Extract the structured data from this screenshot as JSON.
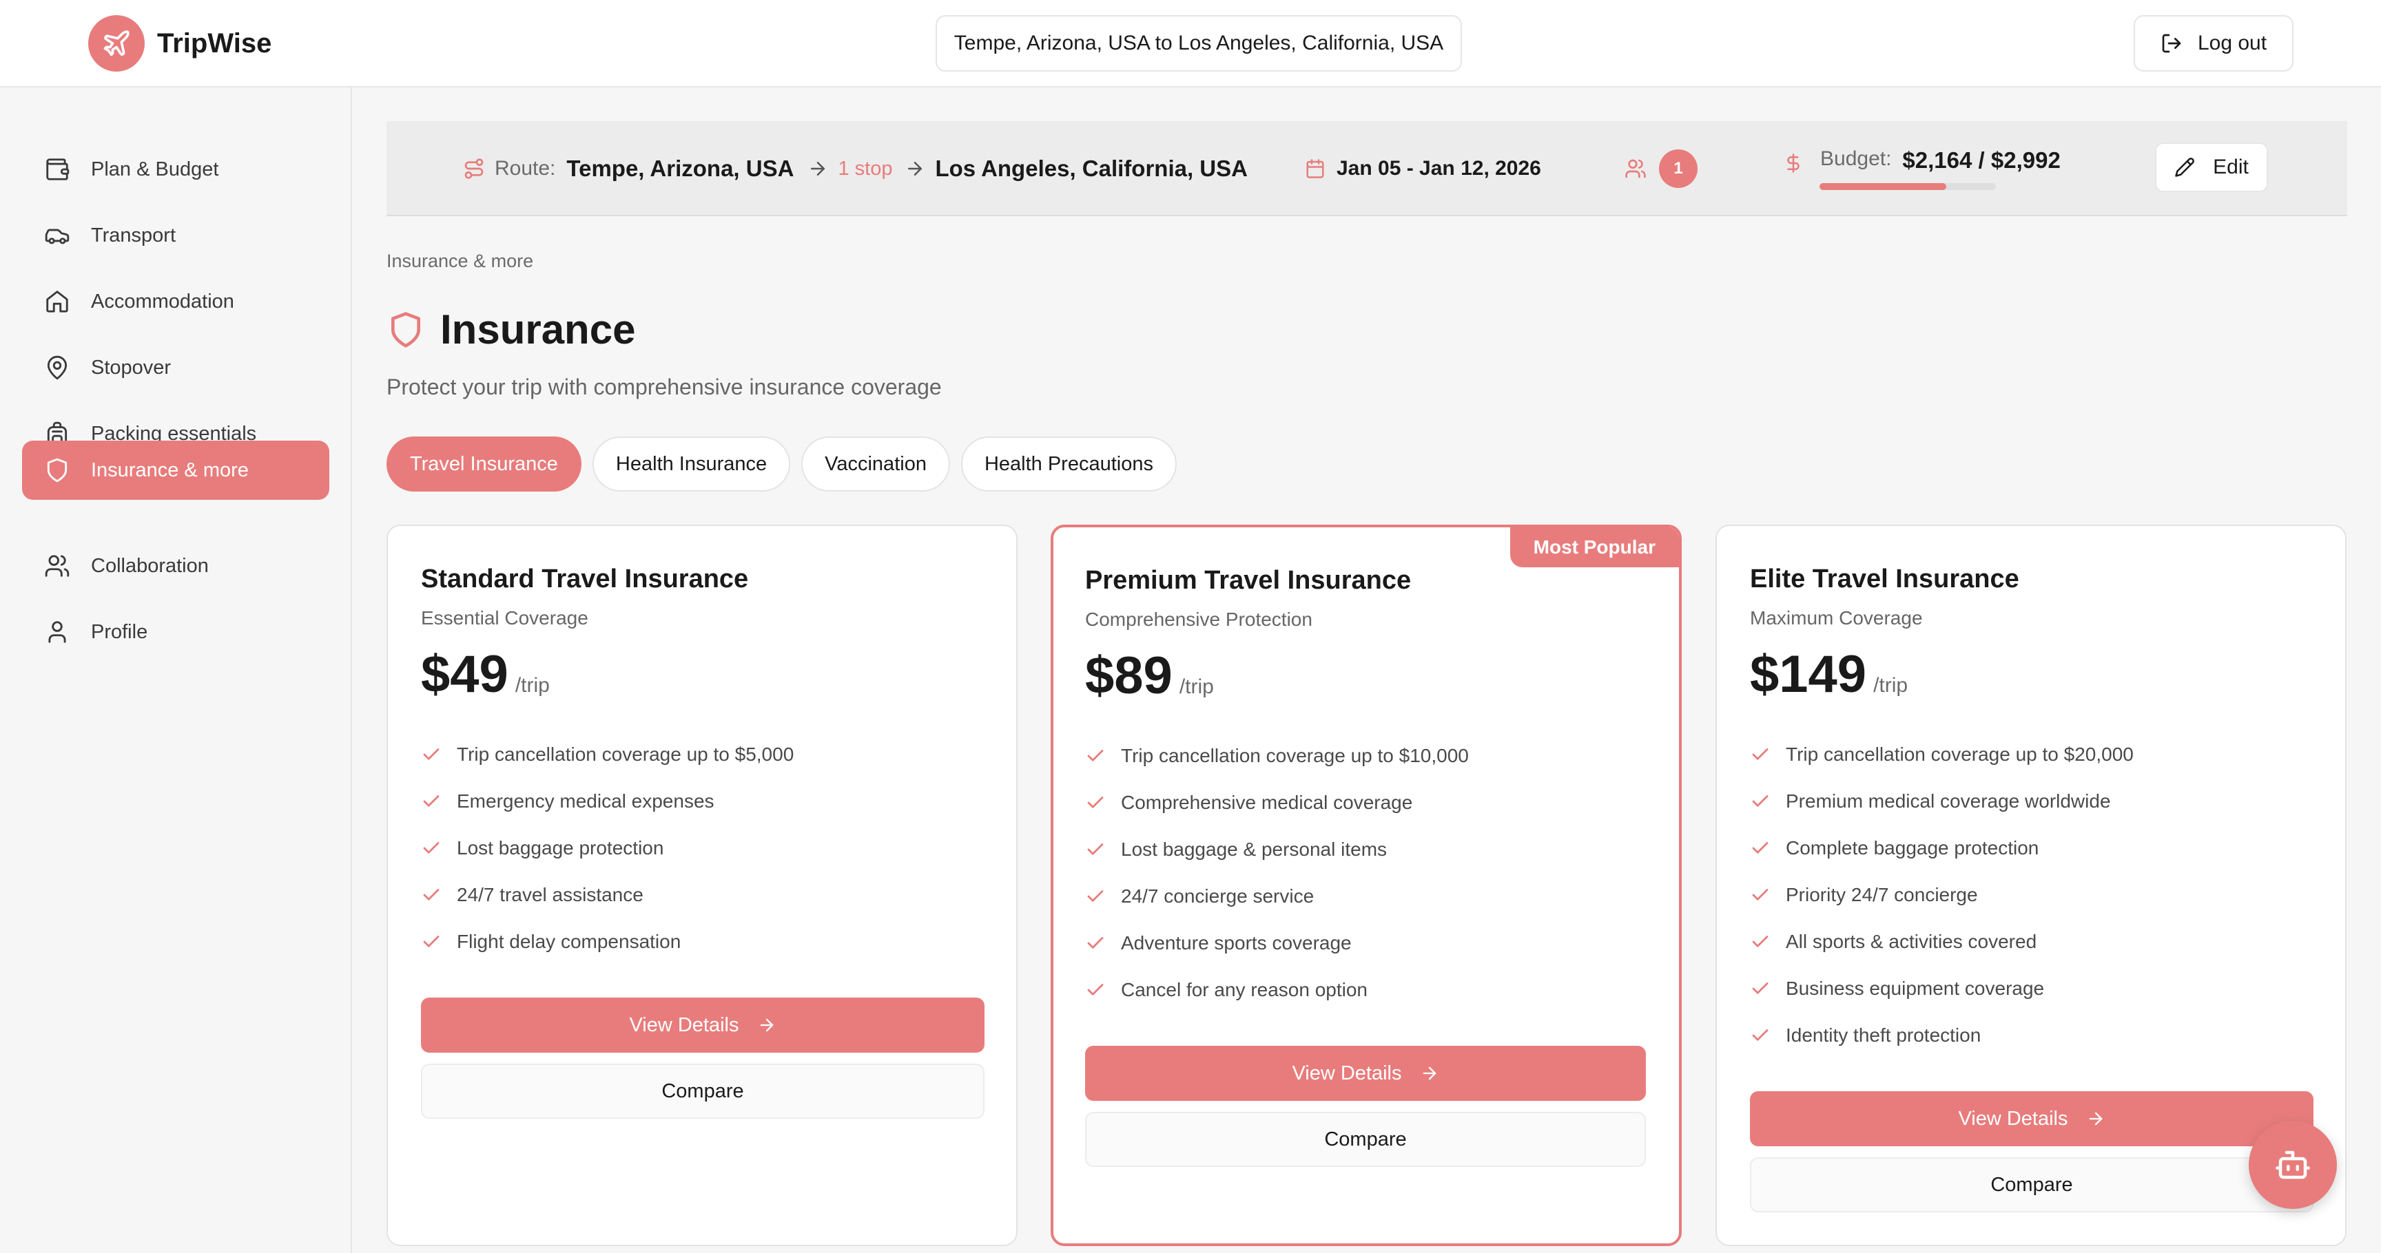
{
  "app": {
    "name": "TripWise",
    "accent": "#e87c7c"
  },
  "header": {
    "route_summary": "Tempe, Arizona, USA to Los Angeles, California, USA",
    "logout_label": "Log out"
  },
  "sidebar": {
    "items": [
      {
        "label": "Plan & Budget",
        "icon": "wallet-icon"
      },
      {
        "label": "Transport",
        "icon": "car-icon"
      },
      {
        "label": "Accommodation",
        "icon": "home-icon"
      },
      {
        "label": "Stopover",
        "icon": "map-pin-icon"
      },
      {
        "label": "Packing essentials",
        "icon": "backpack-icon"
      },
      {
        "label": "Insurance & more",
        "icon": "shield-icon",
        "active": true
      },
      {
        "label": "Collaboration",
        "icon": "users-icon"
      },
      {
        "label": "Profile",
        "icon": "user-icon"
      }
    ]
  },
  "tripbar": {
    "route_label": "Route:",
    "origin": "Tempe, Arizona, USA",
    "stops": "1 stop",
    "destination": "Los Angeles, California, USA",
    "dates": "Jan 05 - Jan 12, 2026",
    "travelers": "1",
    "budget_label": "Budget:",
    "budget_value": "$2,164 / $2,992",
    "budget_fraction": 0.72,
    "edit_label": "Edit"
  },
  "page": {
    "breadcrumb": "Insurance & more",
    "title": "Insurance",
    "subtitle": "Protect your trip with comprehensive insurance coverage"
  },
  "tabs": [
    {
      "label": "Travel Insurance",
      "active": true
    },
    {
      "label": "Health Insurance"
    },
    {
      "label": "Vaccination"
    },
    {
      "label": "Health Precautions"
    }
  ],
  "plans": [
    {
      "title": "Standard Travel Insurance",
      "subtitle": "Essential Coverage",
      "price": "$49",
      "unit": "/trip",
      "features": [
        "Trip cancellation coverage up to $5,000",
        "Emergency medical expenses",
        "Lost baggage protection",
        "24/7 travel assistance",
        "Flight delay compensation"
      ],
      "details_label": "View Details",
      "compare_label": "Compare"
    },
    {
      "title": "Premium Travel Insurance",
      "subtitle": "Comprehensive Protection",
      "price": "$89",
      "unit": "/trip",
      "badge": "Most Popular",
      "features": [
        "Trip cancellation coverage up to $10,000",
        "Comprehensive medical coverage",
        "Lost baggage & personal items",
        "24/7 concierge service",
        "Adventure sports coverage",
        "Cancel for any reason option"
      ],
      "details_label": "View Details",
      "compare_label": "Compare"
    },
    {
      "title": "Elite Travel Insurance",
      "subtitle": "Maximum Coverage",
      "price": "$149",
      "unit": "/trip",
      "features": [
        "Trip cancellation coverage up to $20,000",
        "Premium medical coverage worldwide",
        "Complete baggage protection",
        "Priority 24/7 concierge",
        "All sports & activities covered",
        "Business equipment coverage",
        "Identity theft protection"
      ],
      "details_label": "View Details",
      "compare_label": "Compare"
    }
  ],
  "assistant": {
    "icon": "bot-icon"
  }
}
